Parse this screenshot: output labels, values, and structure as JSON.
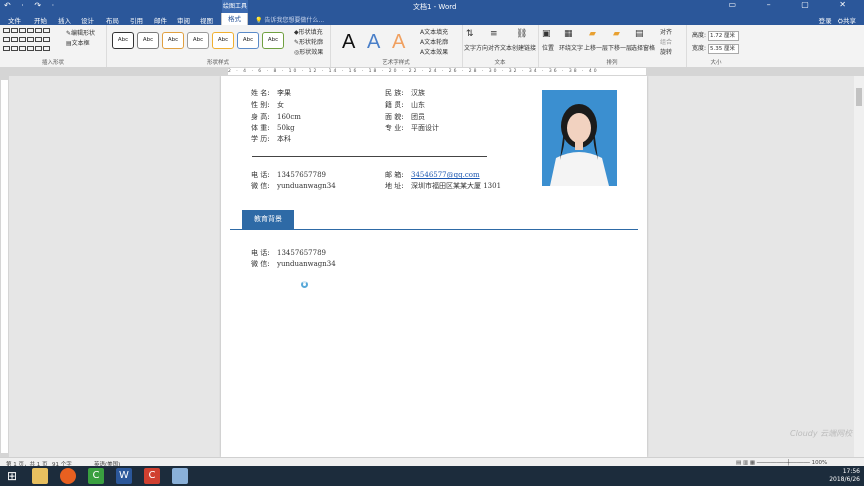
{
  "window": {
    "title": "文档1 - Word",
    "context_tab": "绘图工具",
    "quick_access": "↶ · ↷ ·"
  },
  "tabs": [
    "文件",
    "开始",
    "插入",
    "设计",
    "布局",
    "引用",
    "邮件",
    "审阅",
    "视图",
    "格式"
  ],
  "active_tab": "格式",
  "tell_me": "告诉我您想要做什么...",
  "account": {
    "login": "登录",
    "share": "共享"
  },
  "ribbon": {
    "insert_shapes": {
      "label": "插入形状",
      "edit_shape": "编辑形状",
      "text_box": "文本框"
    },
    "shape_styles": {
      "label": "形状样式",
      "sample": "Abc",
      "fill": "形状填充",
      "outline": "形状轮廓",
      "effect": "形状效果"
    },
    "wordart_styles": {
      "label": "艺术字样式",
      "sample": "A",
      "text_fill": "文本填充",
      "text_outline": "文本轮廓",
      "text_effect": "文本效果"
    },
    "text": {
      "label": "文本",
      "direction": "文字方向",
      "align": "对齐文本",
      "link": "创建链接"
    },
    "arrange": {
      "label": "排列",
      "position": "位置",
      "wrap": "环绕文字",
      "forward": "上移一层",
      "backward": "下移一层",
      "pane": "选择窗格",
      "align": "对齐",
      "group": "组合",
      "rotate": "旋转"
    },
    "size": {
      "label": "大小",
      "height_label": "高度:",
      "height": "1.72 厘米",
      "width_label": "宽度:",
      "width": "5.35 厘米"
    }
  },
  "ruler": {
    "marks": "2 · 4 · 6 · 8 · 10 · 12 · 14 · 16 · 18 · 20 · 22 · 24 · 26 · 28 · 30 · 32 · 34 · 36 · 38 · 40"
  },
  "resume": {
    "personal": [
      {
        "label": "姓  名:",
        "value": "李果"
      },
      {
        "label": "性  别:",
        "value": "女"
      },
      {
        "label": "身  高:",
        "value": "160cm"
      },
      {
        "label": "体  重:",
        "value": "50kg"
      },
      {
        "label": "学  历:",
        "value": "本科"
      }
    ],
    "personal_right": [
      {
        "label": "民  族:",
        "value": "汉族"
      },
      {
        "label": "籍  贯:",
        "value": "山东"
      },
      {
        "label": "面  貌:",
        "value": "团员"
      },
      {
        "label": "专  业:",
        "value": "平面设计"
      }
    ],
    "contact": [
      {
        "label": "电  话:",
        "value": "13457657789"
      },
      {
        "label": "微  信:",
        "value": "yunduanwagn34"
      }
    ],
    "contact_right": [
      {
        "label": "邮  箱:",
        "value": "34546577@qq.com"
      },
      {
        "label": "地  址:",
        "value": "深圳市福田区某某大厦 1301"
      }
    ],
    "section_title": "教育背景",
    "section_contact": [
      {
        "label": "电  话:",
        "value": "13457657789"
      },
      {
        "label": "微  信:",
        "value": "yunduanwagn34"
      }
    ]
  },
  "status": {
    "page": "第 1 页，共 1 页",
    "words": "91 个字",
    "lang": "英语(美国)"
  },
  "tray": {
    "time": "17:56",
    "date": "2018/6/26"
  },
  "watermark": "Cloudy 云端网校",
  "colors": {
    "title_bar": "#2b579a",
    "section_badge": "#2e6aa6",
    "photo_bg": "#3b8fd0"
  }
}
